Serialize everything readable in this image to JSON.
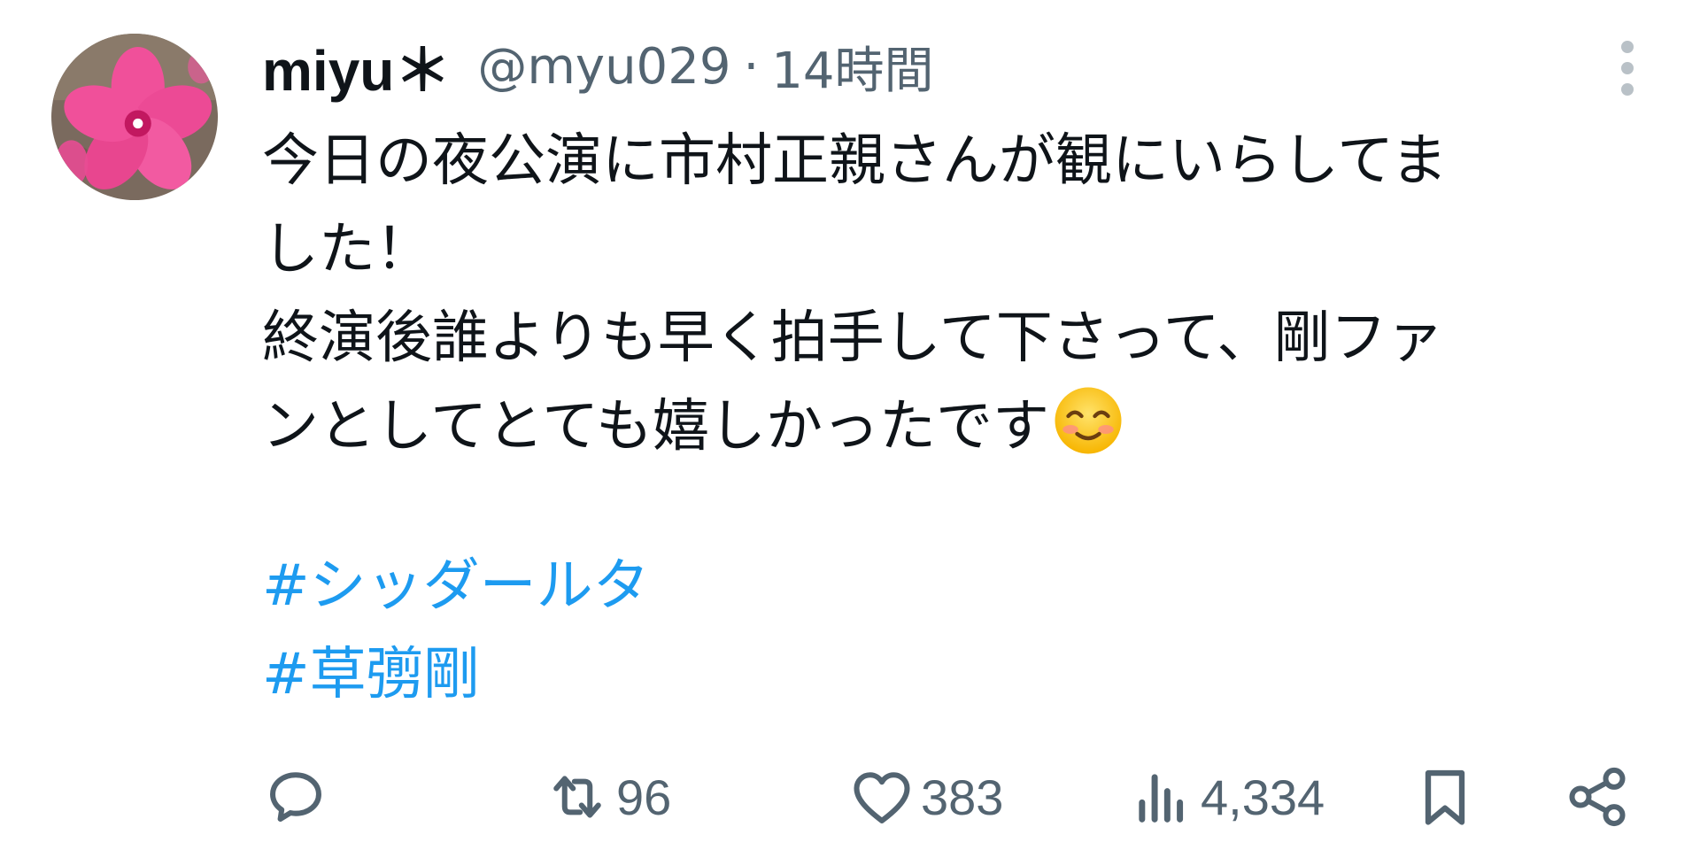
{
  "user": {
    "display_name": "miyu＊",
    "handle": "@myu029",
    "separator": "·",
    "time": "14時間"
  },
  "tweet": {
    "lines": [
      "今日の夜公演に市村正親さんが観にいらしてま",
      "した！",
      "終演後誰よりも早く拍手して下さって、剛ファ",
      "ンとしてとても嬉しかったです"
    ],
    "emoji": "smiling-face-with-smiling-eyes",
    "hashtags": [
      "#シッダールタ",
      "#草彅剛"
    ]
  },
  "actions": {
    "reply": {
      "icon": "reply-icon",
      "count": ""
    },
    "retweet": {
      "icon": "retweet-icon",
      "count": "96"
    },
    "like": {
      "icon": "heart-icon",
      "count": "383"
    },
    "views": {
      "icon": "views-icon",
      "count": "4,334"
    },
    "bookmark": {
      "icon": "bookmark-icon"
    },
    "share": {
      "icon": "share-icon"
    }
  },
  "colors": {
    "text": "#0f1419",
    "secondary": "#536471",
    "link": "#1d9bf0",
    "avatar_flower": "#f0509a"
  }
}
